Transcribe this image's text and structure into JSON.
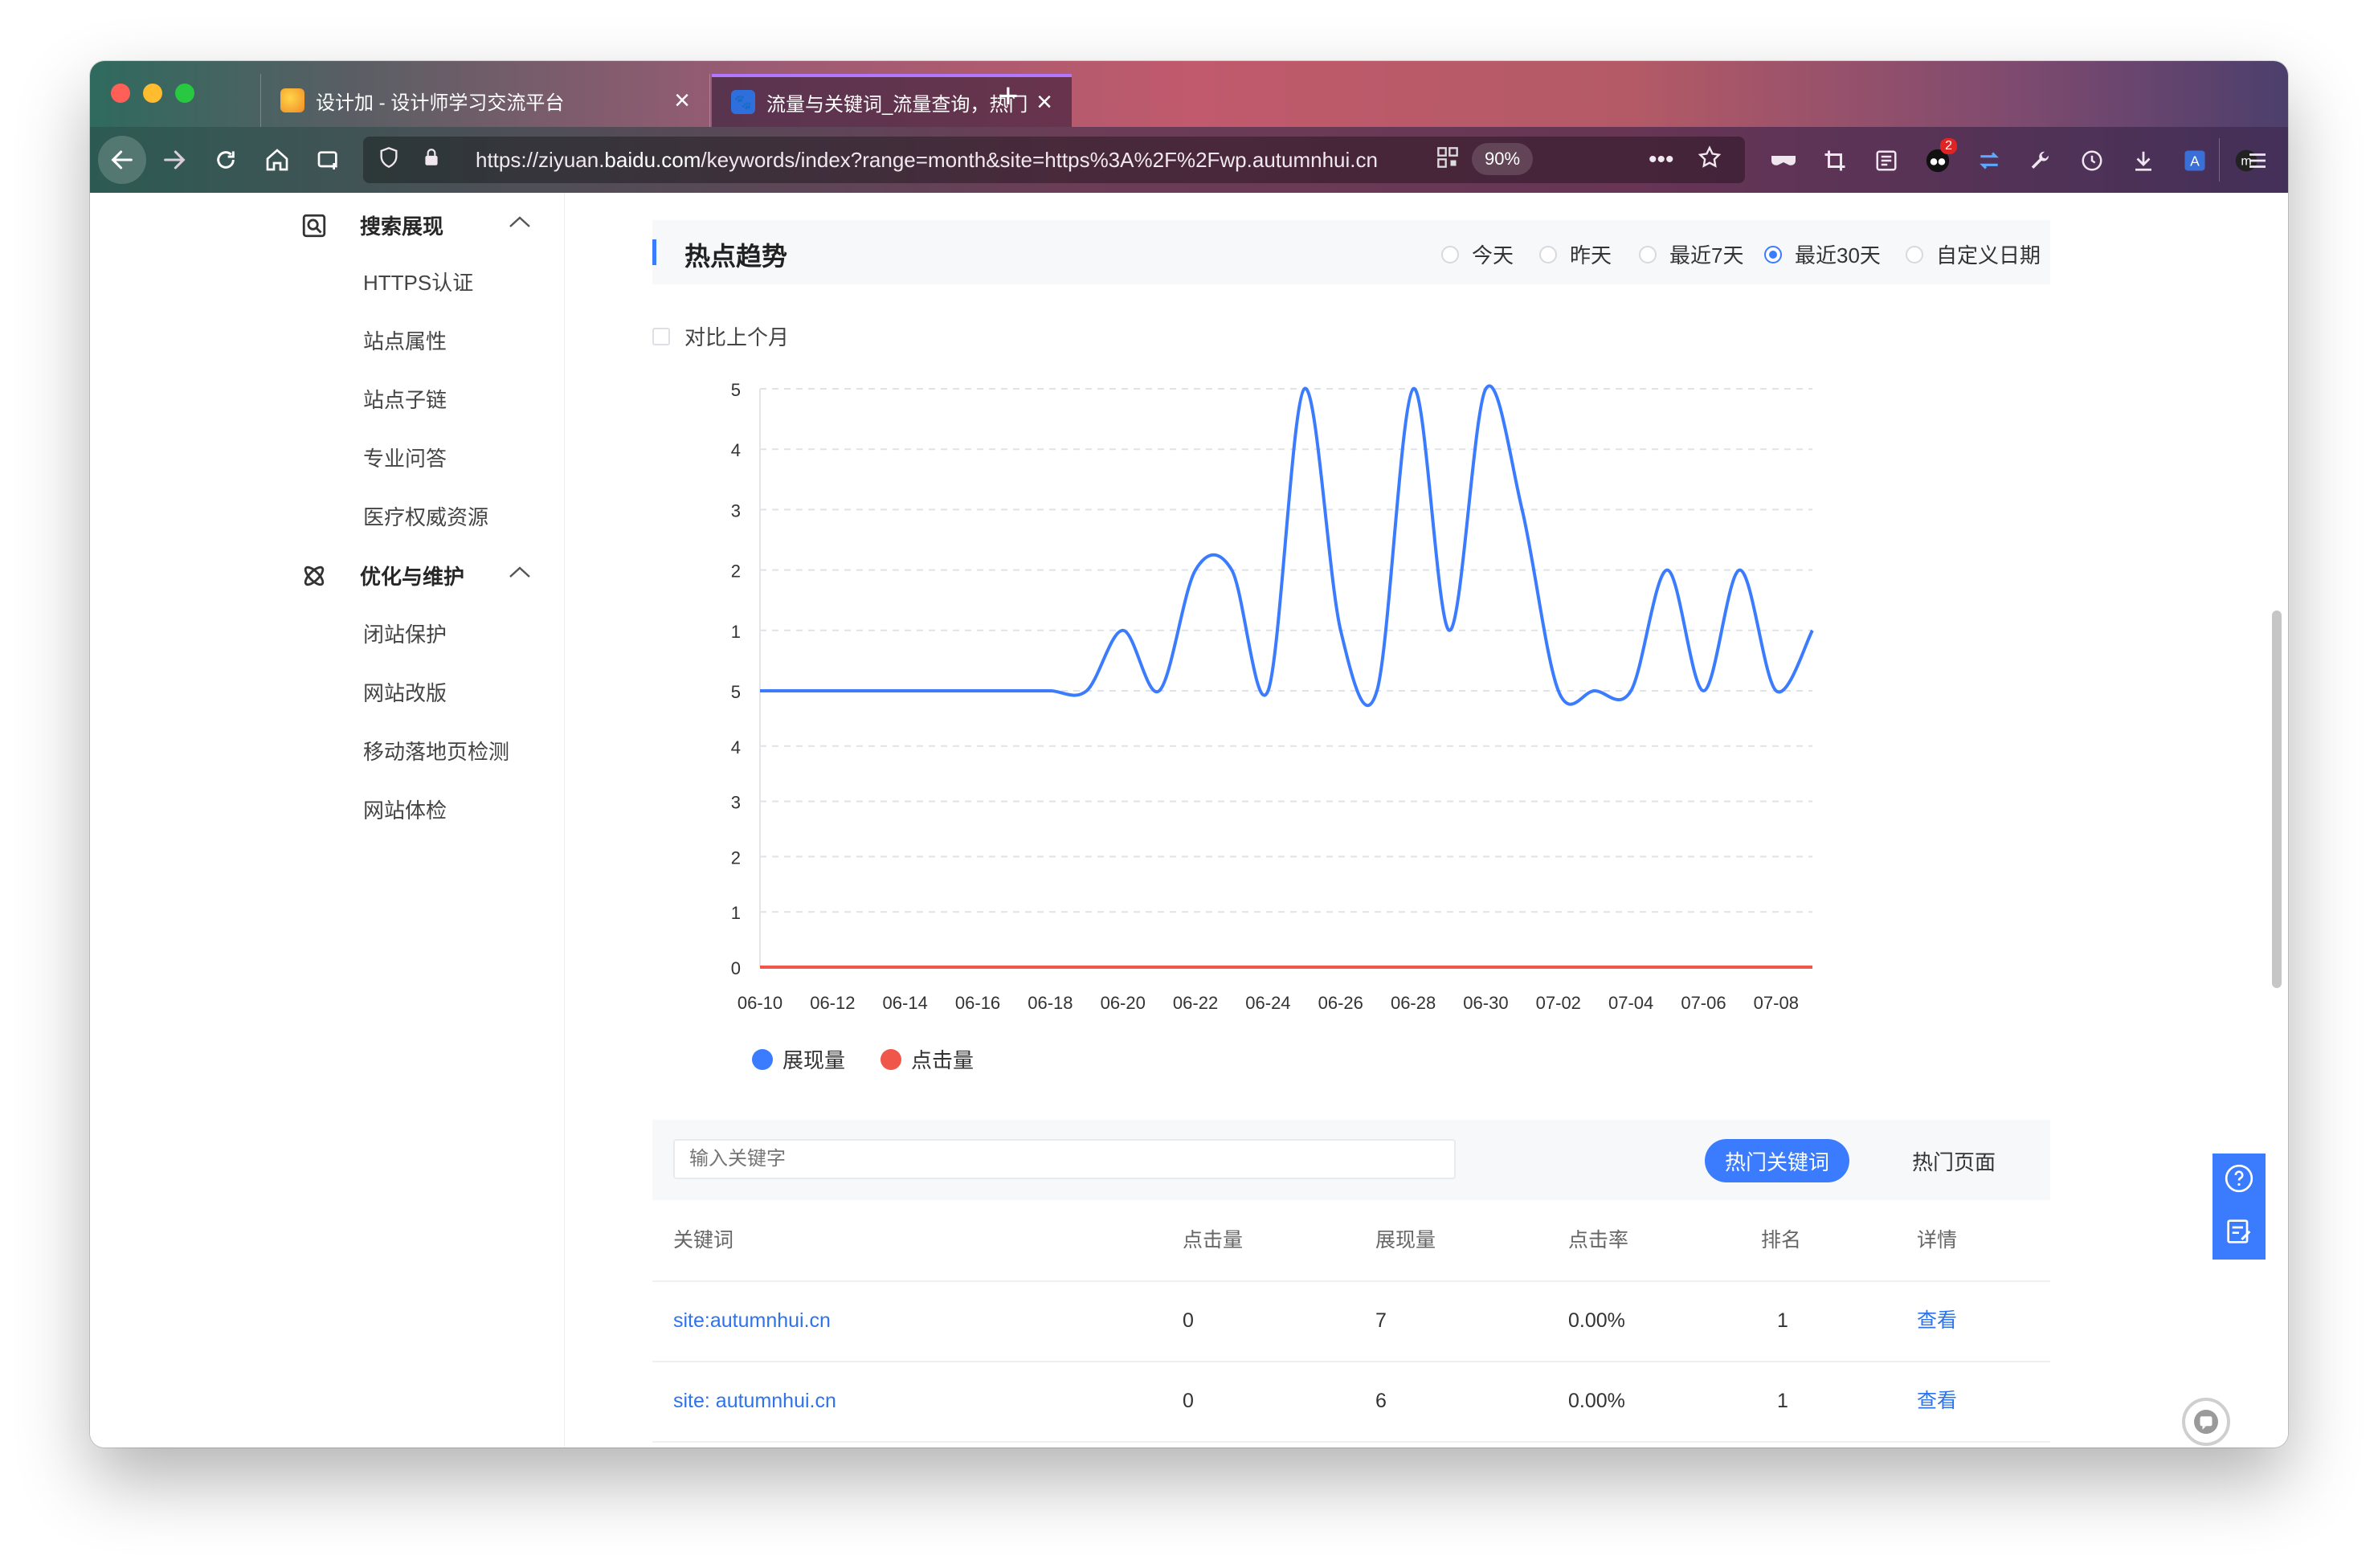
{
  "browser": {
    "tabs": [
      {
        "title": "设计加 - 设计师学习交流平台",
        "active": false
      },
      {
        "title": "流量与关键词_流量查询，热门关键词",
        "active": true
      }
    ],
    "url_prefix": "https://ziyuan.",
    "url_domain": "baidu.com",
    "url_rest": "/keywords/index?range=month&site=https%3A%2F%2Fwp.autumnhui.cn",
    "zoom": "90%",
    "badge_count": "2",
    "icons": [
      "back-icon",
      "forward-icon",
      "reload-icon",
      "home-icon",
      "new-container-icon",
      "shield-icon",
      "lock-icon",
      "qr-icon",
      "more-icon",
      "star-icon",
      "mask-icon",
      "crop-icon",
      "reader-icon",
      "extension-icon",
      "sync-icon",
      "wrench-icon",
      "history-icon",
      "download-icon",
      "translate-icon",
      "account-icon",
      "menu-icon"
    ]
  },
  "sidebar": {
    "sections": [
      {
        "label": "搜索展现",
        "icon": "search-display-icon",
        "items": [
          "HTTPS认证",
          "站点属性",
          "站点子链",
          "专业问答",
          "医疗权威资源"
        ]
      },
      {
        "label": "优化与维护",
        "icon": "atom-icon",
        "items": [
          "闭站保护",
          "网站改版",
          "移动落地页检测",
          "网站体检"
        ]
      }
    ]
  },
  "trend": {
    "title": "热点趋势",
    "ranges": [
      "今天",
      "昨天",
      "最近7天",
      "最近30天",
      "自定义日期"
    ],
    "selected_range": "最近30天",
    "compare_label": "对比上个月"
  },
  "chart_data": {
    "type": "line",
    "title": "",
    "x": [
      "06-10",
      "06-11",
      "06-12",
      "06-13",
      "06-14",
      "06-15",
      "06-16",
      "06-17",
      "06-18",
      "06-19",
      "06-20",
      "06-21",
      "06-22",
      "06-23",
      "06-24",
      "06-25",
      "06-26",
      "06-27",
      "06-28",
      "06-29",
      "06-30",
      "07-01",
      "07-02",
      "07-03",
      "07-04",
      "07-05",
      "07-06",
      "07-07",
      "07-08",
      "07-09"
    ],
    "x_tick_labels": [
      "06-10",
      "06-12",
      "06-14",
      "06-16",
      "06-18",
      "06-20",
      "06-22",
      "06-24",
      "06-26",
      "06-28",
      "06-30",
      "07-02",
      "07-04",
      "07-06",
      "07-08"
    ],
    "upper_axis": {
      "ticks": [
        "5",
        "4",
        "3",
        "2",
        "1",
        "5"
      ],
      "range": [
        0,
        5
      ]
    },
    "lower_axis": {
      "ticks": [
        "4",
        "3",
        "2",
        "1",
        "0"
      ],
      "range": [
        0,
        5
      ]
    },
    "series": [
      {
        "name": "展现量",
        "color": "#3b7cff",
        "axis": "upper",
        "values": [
          0,
          0,
          0,
          0,
          0,
          0,
          0,
          0,
          0,
          0,
          1,
          0,
          2,
          2,
          0,
          5,
          1,
          0,
          5,
          1,
          5,
          3,
          0,
          0,
          0,
          2,
          0,
          2,
          0,
          1
        ]
      },
      {
        "name": "点击量",
        "color": "#f0564a",
        "axis": "lower",
        "values": [
          0,
          0,
          0,
          0,
          0,
          0,
          0,
          0,
          0,
          0,
          0,
          0,
          0,
          0,
          0,
          0,
          0,
          0,
          0,
          0,
          0,
          0,
          0,
          0,
          0,
          0,
          0,
          0,
          0,
          0
        ]
      }
    ],
    "grid": true,
    "legend_position": "bottom-left"
  },
  "keywords": {
    "search_placeholder": "输入关键字",
    "tab_hot_keywords": "热门关键词",
    "tab_hot_pages": "热门页面",
    "columns": [
      "关键词",
      "点击量",
      "展现量",
      "点击率",
      "排名",
      "详情"
    ],
    "rows": [
      {
        "keyword": "site:autumnhui.cn",
        "clicks": "0",
        "impressions": "7",
        "ctr": "0.00%",
        "rank": "1",
        "detail": "查看"
      },
      {
        "keyword": "site: autumnhui.cn",
        "clicks": "0",
        "impressions": "6",
        "ctr": "0.00%",
        "rank": "1",
        "detail": "查看"
      }
    ]
  }
}
